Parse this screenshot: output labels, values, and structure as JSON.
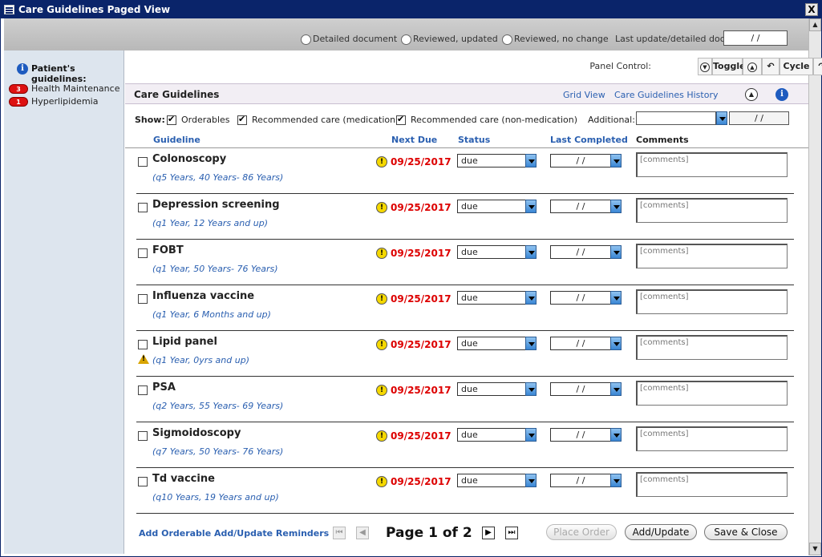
{
  "window": {
    "title": "Care Guidelines Paged View",
    "close_glyph": "X"
  },
  "topbar": {
    "radios": [
      "Detailed document",
      "Reviewed, updated",
      "Reviewed, no change"
    ],
    "last_update_label": "Last update/detailed doc:",
    "last_update_value": " / /"
  },
  "sidebar": {
    "header": "Patient's guidelines:",
    "items": [
      {
        "count": "3",
        "label": "Health Maintenance"
      },
      {
        "count": "1",
        "label": "Hyperlipidemia"
      }
    ]
  },
  "panel_control": {
    "label": "Panel Control:",
    "toggle": "Toggle",
    "cycle": "Cycle"
  },
  "care_header": {
    "title": "Care Guidelines",
    "grid_view": "Grid View",
    "history": "Care Guidelines History"
  },
  "show": {
    "label": "Show:",
    "options": [
      "Orderables",
      "Recommended care (medication)",
      "Recommended care (non-medication)"
    ],
    "additional_label": "Additional:",
    "additional_date": " / /"
  },
  "columns": {
    "guideline": "Guideline",
    "next_due": "Next Due",
    "status": "Status",
    "last_completed": "Last Completed",
    "comments": "Comments"
  },
  "rows": [
    {
      "name": "Colonoscopy",
      "freq": "(q5 Years, 40 Years- 86 Years)",
      "next_due": "09/25/2017",
      "status": "due",
      "last": " / /",
      "comment": "[comments]",
      "warn": false
    },
    {
      "name": "Depression screening",
      "freq": "(q1 Year, 12 Years and up)",
      "next_due": "09/25/2017",
      "status": "due",
      "last": " / /",
      "comment": "[comments]",
      "warn": false
    },
    {
      "name": "FOBT",
      "freq": "(q1 Year, 50 Years- 76 Years)",
      "next_due": "09/25/2017",
      "status": "due",
      "last": " / /",
      "comment": "[comments]",
      "warn": false
    },
    {
      "name": "Influenza vaccine",
      "freq": "(q1 Year, 6 Months and up)",
      "next_due": "09/25/2017",
      "status": "due",
      "last": " / /",
      "comment": "[comments]",
      "warn": false
    },
    {
      "name": "Lipid panel",
      "freq": "(q1 Year, 0yrs and up)",
      "next_due": "09/25/2017",
      "status": "due",
      "last": " / /",
      "comment": "[comments]",
      "warn": true
    },
    {
      "name": "PSA",
      "freq": "(q2 Years, 55 Years- 69 Years)",
      "next_due": "09/25/2017",
      "status": "due",
      "last": " / /",
      "comment": "[comments]",
      "warn": false
    },
    {
      "name": "Sigmoidoscopy",
      "freq": "(q7 Years, 50 Years- 76 Years)",
      "next_due": "09/25/2017",
      "status": "due",
      "last": " / /",
      "comment": "[comments]",
      "warn": false
    },
    {
      "name": "Td vaccine",
      "freq": "(q10 Years, 19 Years and up)",
      "next_due": "09/25/2017",
      "status": "due",
      "last": " / /",
      "comment": "[comments]",
      "warn": false
    }
  ],
  "footer": {
    "add_orderable": "Add Orderable",
    "add_update_reminders": "Add/Update Reminders",
    "page_info": "Page 1 of 2",
    "place_order": "Place Order",
    "add_update": "Add/Update",
    "save_close": "Save & Close"
  }
}
